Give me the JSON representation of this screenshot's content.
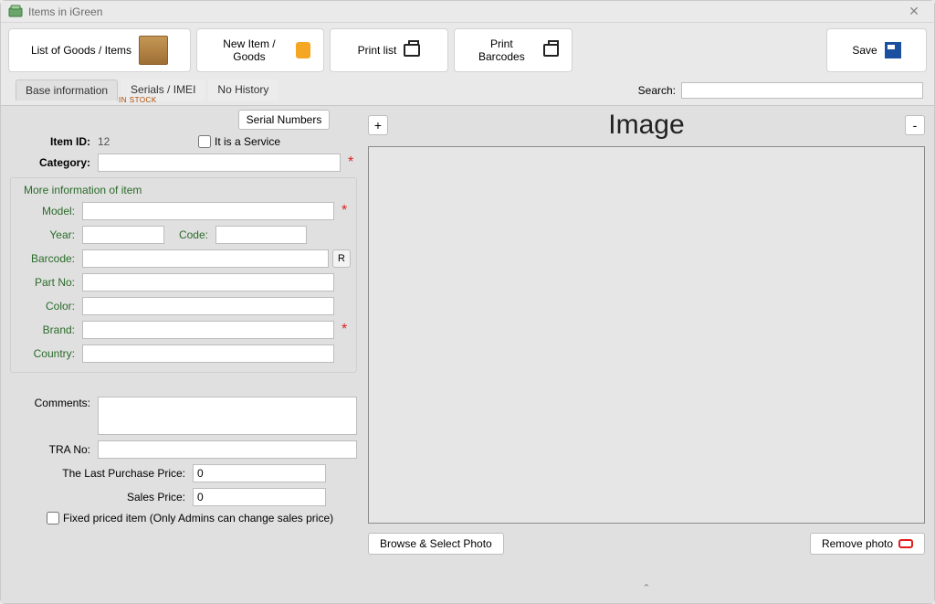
{
  "window": {
    "title": "Items in iGreen"
  },
  "toolbar": {
    "list_goods": "List of Goods / Items",
    "list_goods_sub": "IN STOCK",
    "new_item": "New Item / Goods",
    "print_list": "Print list",
    "print_barcodes": "Print Barcodes",
    "save": "Save"
  },
  "search": {
    "label": "Search:",
    "value": ""
  },
  "tabs": {
    "base": "Base information",
    "serials": "Serials / IMEI",
    "history": "No History"
  },
  "form": {
    "serial_numbers_btn": "Serial Numbers",
    "is_service_label": "It is a Service",
    "is_service_checked": false,
    "item_id_label": "Item ID:",
    "item_id_value": "12",
    "category_label": "Category:",
    "category_value": "",
    "fieldset_title": "More information of item",
    "model_label": "Model:",
    "model_value": "",
    "year_label": "Year:",
    "year_value": "",
    "code_label": "Code:",
    "code_value": "",
    "barcode_label": "Barcode:",
    "barcode_value": "",
    "r_btn": "R",
    "partno_label": "Part No:",
    "partno_value": "",
    "color_label": "Color:",
    "color_value": "",
    "brand_label": "Brand:",
    "brand_value": "",
    "country_label": "Country:",
    "country_value": "",
    "comments_label": "Comments:",
    "comments_value": "",
    "tra_label": "TRA No:",
    "tra_value": "",
    "last_purchase_label": "The Last Purchase Price:",
    "last_purchase_value": "0",
    "sales_price_label": "Sales Price:",
    "sales_price_value": "0",
    "fixed_price_label": "Fixed priced item (Only Admins can change sales price)",
    "fixed_price_checked": false
  },
  "image": {
    "title": "Image",
    "plus": "+",
    "minus": "-",
    "browse_btn": "Browse & Select Photo",
    "remove_btn": "Remove photo"
  }
}
